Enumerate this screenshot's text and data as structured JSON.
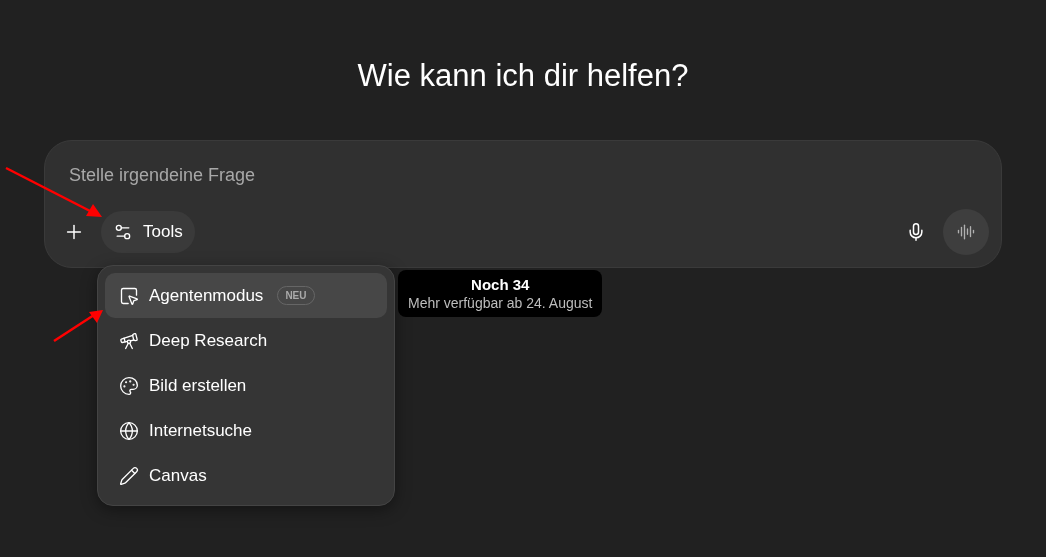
{
  "heading": "Wie kann ich dir helfen?",
  "composer": {
    "placeholder": "Stelle irgendeine Frage",
    "tools_label": "Tools"
  },
  "tools_menu": {
    "items": [
      {
        "label": "Agentenmodus",
        "badge": "NEU",
        "selected": true
      },
      {
        "label": "Deep Research",
        "selected": false
      },
      {
        "label": "Bild erstellen",
        "selected": false
      },
      {
        "label": "Internetsuche",
        "selected": false
      },
      {
        "label": "Canvas",
        "selected": false
      }
    ]
  },
  "tooltip": {
    "title": "Noch 34",
    "subtitle": "Mehr verfügbar ab 24. August"
  }
}
